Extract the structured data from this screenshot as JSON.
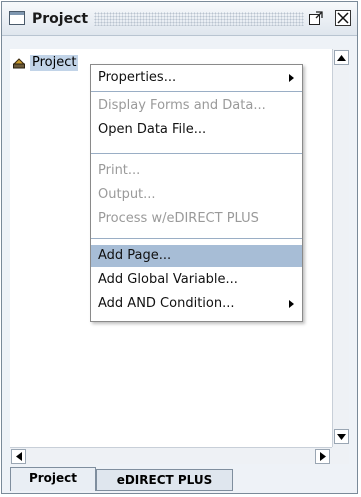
{
  "window": {
    "title": "Project"
  },
  "tree": {
    "root_label": "Project"
  },
  "context_menu": {
    "items": [
      {
        "label": "Properties...",
        "enabled": true,
        "submenu": true
      },
      {
        "label": "Display Forms and Data...",
        "enabled": false,
        "submenu": false
      },
      {
        "label": "Open Data File...",
        "enabled": true,
        "submenu": false
      },
      {
        "label": "Print...",
        "enabled": false,
        "submenu": false
      },
      {
        "label": "Output...",
        "enabled": false,
        "submenu": false
      },
      {
        "label": "Process w/eDIRECT PLUS",
        "enabled": false,
        "submenu": false
      },
      {
        "label": "Add Page...",
        "enabled": true,
        "submenu": false,
        "selected": true
      },
      {
        "label": "Add Global Variable...",
        "enabled": true,
        "submenu": false
      },
      {
        "label": "Add AND Condition...",
        "enabled": true,
        "submenu": true
      }
    ]
  },
  "tabs": [
    {
      "label": "Project",
      "active": true
    },
    {
      "label": "eDIRECT PLUS",
      "active": false
    }
  ],
  "colors": {
    "selection": "#a7bdd6",
    "tree_selection": "#c2d4e8",
    "disabled_text": "#9a9a9a"
  }
}
